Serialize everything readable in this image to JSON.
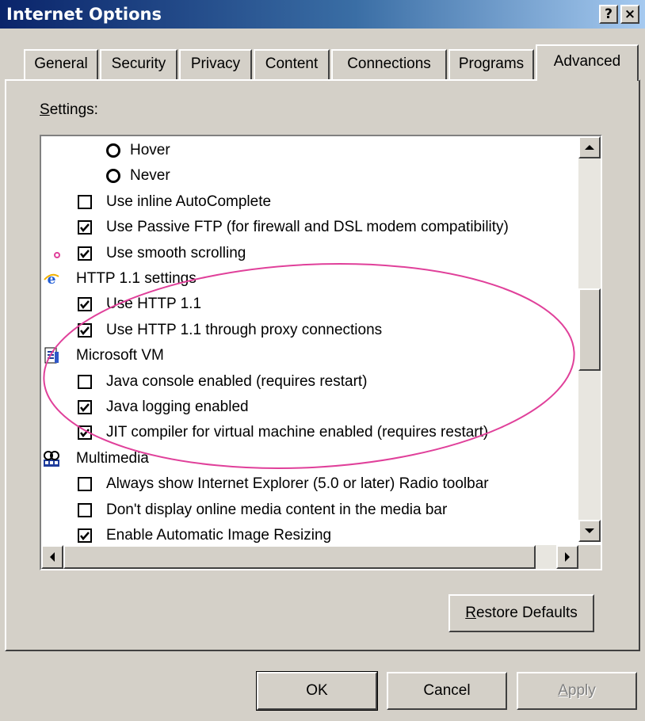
{
  "window": {
    "title": "Internet Options",
    "help_button": "?",
    "close_button": "×"
  },
  "tabs": [
    {
      "label": "General"
    },
    {
      "label": "Security"
    },
    {
      "label": "Privacy"
    },
    {
      "label": "Content"
    },
    {
      "label": "Connections"
    },
    {
      "label": "Programs"
    },
    {
      "label": "Advanced",
      "active": true
    }
  ],
  "settings": {
    "label_prefix": "S",
    "label_rest": "ettings:",
    "items": [
      {
        "type": "radio",
        "label": "Hover",
        "checked": false
      },
      {
        "type": "radio",
        "label": "Never",
        "checked": false
      },
      {
        "type": "checkbox",
        "label": "Use inline AutoComplete",
        "checked": false
      },
      {
        "type": "checkbox",
        "label": "Use Passive FTP (for firewall and DSL modem compatibility)",
        "checked": true
      },
      {
        "type": "checkbox",
        "label": "Use smooth scrolling",
        "checked": true
      },
      {
        "type": "category",
        "label": "HTTP 1.1 settings",
        "icon": "ie-logo-icon"
      },
      {
        "type": "checkbox",
        "label": "Use HTTP 1.1",
        "checked": true
      },
      {
        "type": "checkbox",
        "label": "Use HTTP 1.1 through proxy connections",
        "checked": true
      },
      {
        "type": "category",
        "label": "Microsoft VM",
        "icon": "document-icon"
      },
      {
        "type": "checkbox",
        "label": "Java console enabled (requires restart)",
        "checked": false
      },
      {
        "type": "checkbox",
        "label": "Java logging enabled",
        "checked": true
      },
      {
        "type": "checkbox",
        "label": "JIT compiler for virtual machine enabled (requires restart)",
        "checked": true
      },
      {
        "type": "category",
        "label": "Multimedia",
        "icon": "multimedia-icon"
      },
      {
        "type": "checkbox",
        "label": "Always show Internet Explorer (5.0 or later) Radio toolbar",
        "checked": false
      },
      {
        "type": "checkbox",
        "label": "Don't display online media content in the media bar",
        "checked": false
      },
      {
        "type": "checkbox",
        "label": "Enable Automatic Image Resizing",
        "checked": true
      }
    ]
  },
  "buttons": {
    "restore_prefix": "R",
    "restore_rest": "estore Defaults",
    "ok": "OK",
    "cancel": "Cancel",
    "apply_prefix": "A",
    "apply_rest": "pply"
  },
  "colors": {
    "title_start": "#0a246a",
    "title_end": "#a6caf0",
    "face": "#d4d0c8",
    "annotation": "#e0409a"
  }
}
